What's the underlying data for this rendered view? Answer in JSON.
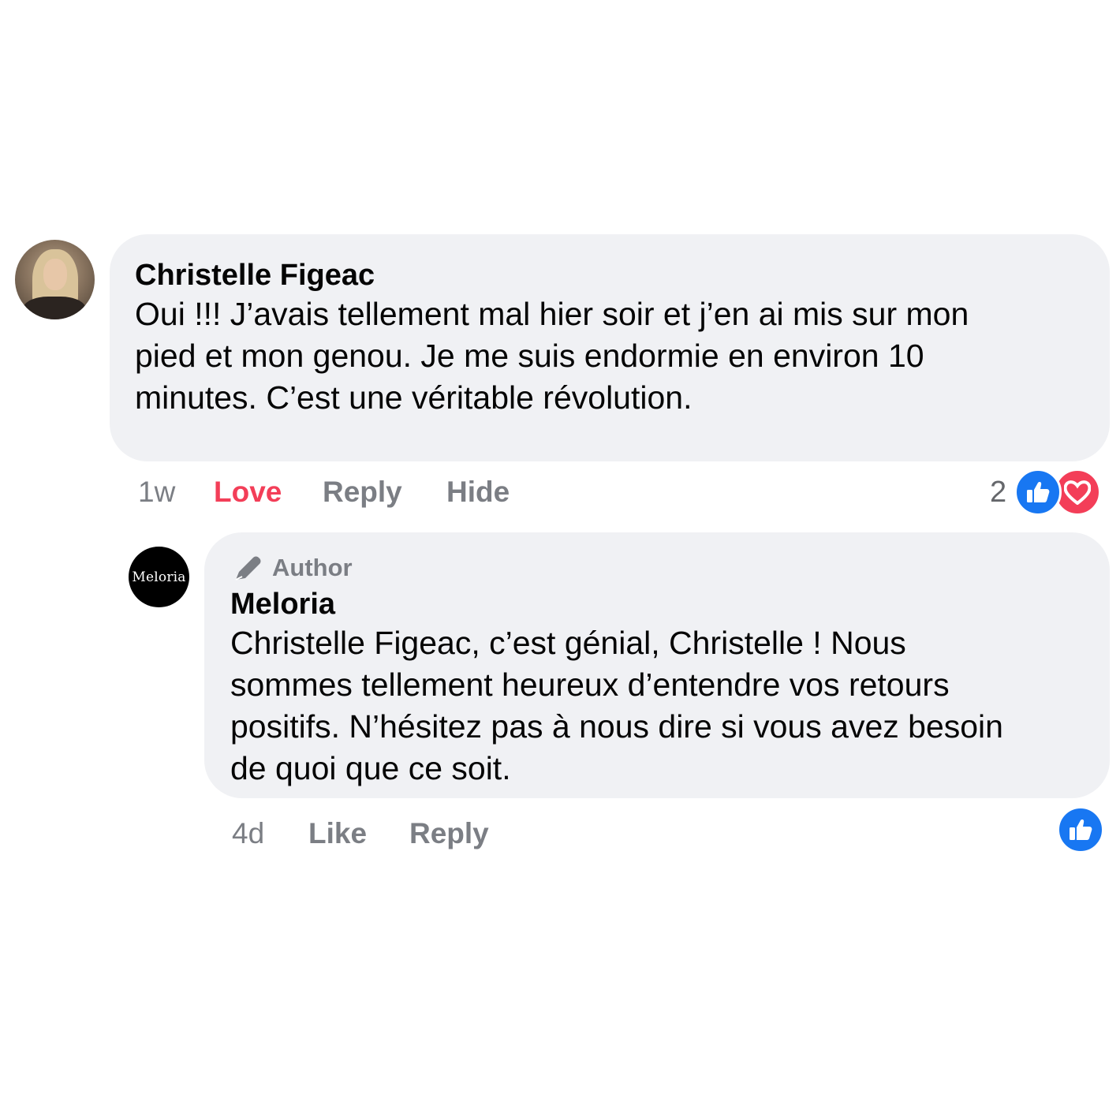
{
  "comments": [
    {
      "author": "Christelle Figeac",
      "lines": [
        "Oui !!! J’avais tellement mal hier soir et j’en ai mis sur mon",
        "pied et mon genou. Je me suis endormie en environ 10",
        "minutes. C’est une véritable révolution."
      ],
      "time": "1w",
      "actions": [
        "Love",
        "Reply",
        "Hide"
      ],
      "reaction_count": "2",
      "reactions": [
        "like-icon",
        "love-icon"
      ]
    },
    {
      "badge": "Author",
      "author": "Meloria",
      "avatar_text": "Meloria",
      "lines": [
        "Christelle Figeac, c’est génial, Christelle ! Nous",
        "sommes tellement heureux d’entendre vos retours",
        "positifs. N’hésitez pas à nous dire si vous avez besoin",
        "de quoi que ce soit."
      ],
      "time": "4d",
      "actions": [
        "Like",
        "Reply"
      ],
      "reactions": [
        "like-icon"
      ]
    }
  ],
  "colors": {
    "bubble": "#f0f1f4",
    "like_blue": "#1877f2",
    "love_red": "#f33e58",
    "meta_gray": "#7b7e84"
  }
}
